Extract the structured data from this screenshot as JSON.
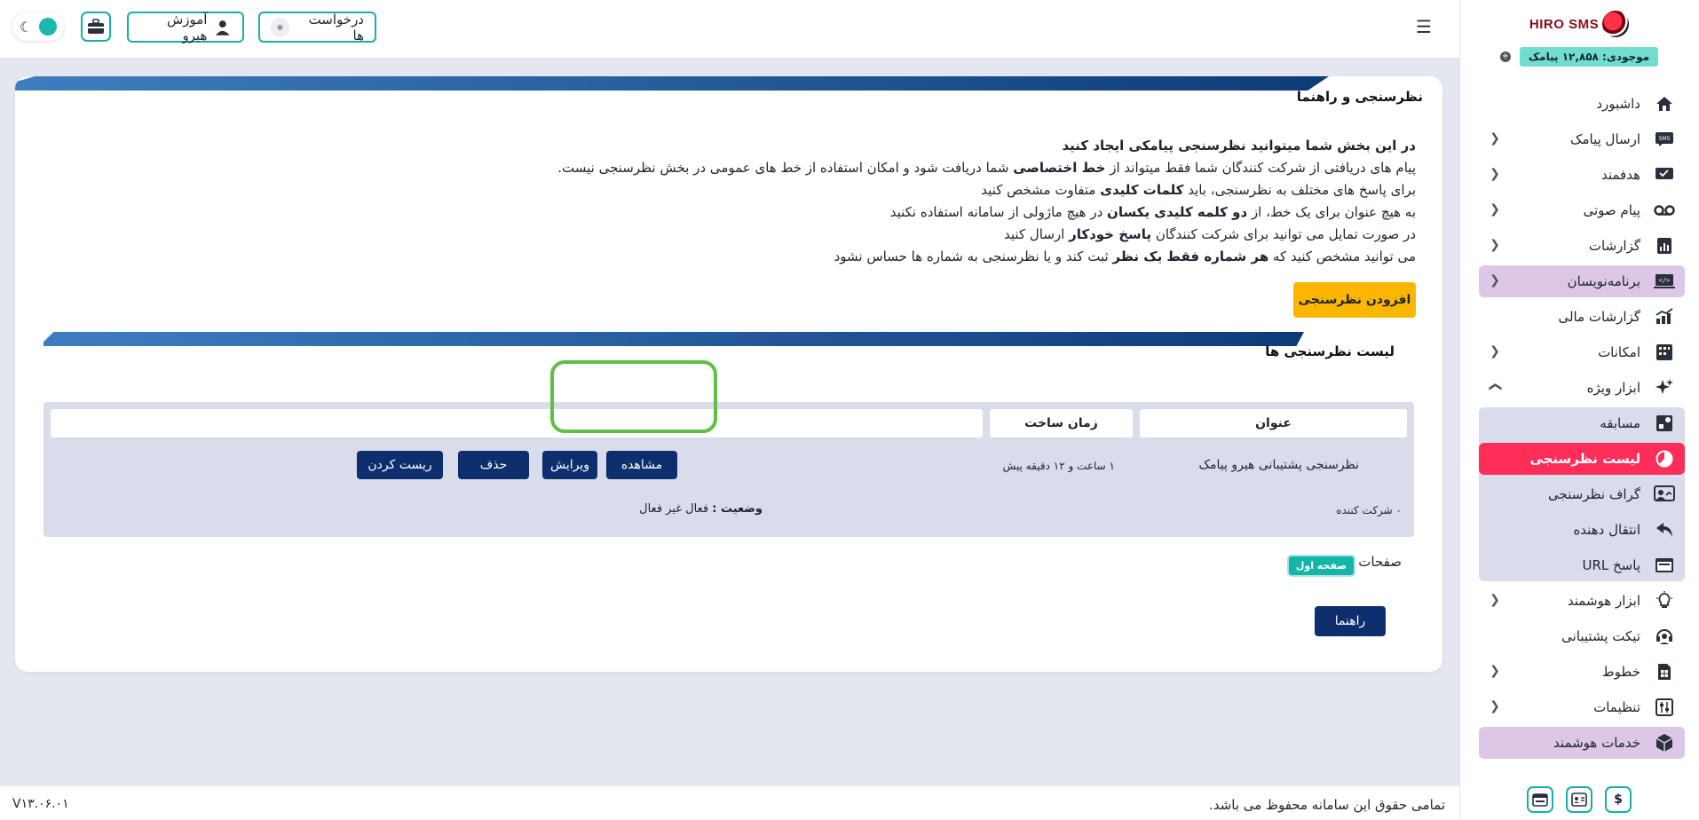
{
  "brand": {
    "logo_text": "HIRO SMS"
  },
  "balance": {
    "label": "موجودی: ۱۲,۸۵۸ پیامک",
    "add": "+"
  },
  "topbar": {
    "requests_label": "درخواست ها",
    "training_label": "آموزش هیرو"
  },
  "sidebar": {
    "items": [
      {
        "label": "داشبورد"
      },
      {
        "label": "ارسال پیامک"
      },
      {
        "label": "هدفمند"
      },
      {
        "label": "پیام صوتی"
      },
      {
        "label": "گزارشات"
      },
      {
        "label": "برنامه‌نویسان"
      },
      {
        "label": "گزارشات مالی"
      },
      {
        "label": "امکانات"
      },
      {
        "label": "ابزار ویژه"
      },
      {
        "label": "مسابقه"
      },
      {
        "label": "لیست نظرسنجی"
      },
      {
        "label": "گراف نظرسنجی"
      },
      {
        "label": "انتقال دهنده"
      },
      {
        "label": "پاسخ URL"
      },
      {
        "label": "ابزار هوشمند"
      },
      {
        "label": "تیکت پشتیبانی"
      },
      {
        "label": "خطوط"
      },
      {
        "label": "تنظیمات"
      },
      {
        "label": "خدمات هوشمند"
      }
    ],
    "footer_buttons": [
      "$"
    ]
  },
  "card": {
    "title": "نظرسنجی و راهنما",
    "intro": {
      "lead": "در این بخش شما میتوانید نظرسنجی پیامکی ایجاد کنید",
      "line1_a": "پیام های دریافتی از شرکت کنندگان شما فقط میتواند از ",
      "line1_b": "خط اختصاصی",
      "line1_c": " شما دریافت شود و امکان استفاده از خط های عمومی در بخش نظرسنجی نیست.",
      "line2_a": "برای پاسخ های مختلف به نظرسنجی، باید ",
      "line2_b": "کلمات کلیدی",
      "line2_c": " متفاوت مشخص کنید",
      "line3_a": "به هیچ عنوان برای یک خط، از ",
      "line3_b": "دو کلمه کلیدی یکسان",
      "line3_c": " در هیچ ماژولی از سامانه استفاده نکنید",
      "line4_a": "در صورت تمایل می توانید برای شرکت کنندگان ",
      "line4_b": "پاسخ خودکار",
      "line4_c": " ارسال کنید",
      "line5_a": "می توانید مشخص کنید که ",
      "line5_b": "هر شماره فقط یک نظر",
      "line5_c": " ثبت کند و یا نظرسنجی به شماره ها حساس نشود"
    },
    "add_button": "افزودن نظرسنجی",
    "list_title": "لیست نظرسنجی ها",
    "table": {
      "headers": [
        "عنوان",
        "زمان ساخت",
        ""
      ],
      "row": {
        "title": "نظرسنجی پشتیبانی هیرو پیامک",
        "created": "۱ ساعت و ۱۲ دقیقه پیش",
        "participants": "۰ شرکت کننده",
        "status_label": "وضعیت :",
        "status_value": " فعال غیر فعال",
        "actions": [
          "مشاهده",
          "ویرایش",
          "حذف",
          "ریست کردن"
        ]
      }
    },
    "pages_label": "صفحات :",
    "first_page": "صفحه اول",
    "help_button": "راهنما"
  },
  "footer": {
    "copyright": "تمامی حقوق این سامانه محفوظ می باشد.",
    "version": "V۱۳.۰۶.۰۱"
  },
  "colors": {
    "accent_teal": "#16b0aa",
    "primary_navy": "#0d2f6e",
    "active_pink": "#fd2f58",
    "warning_yellow": "#fbb700",
    "highlight_purple": "#dcc8e6"
  }
}
